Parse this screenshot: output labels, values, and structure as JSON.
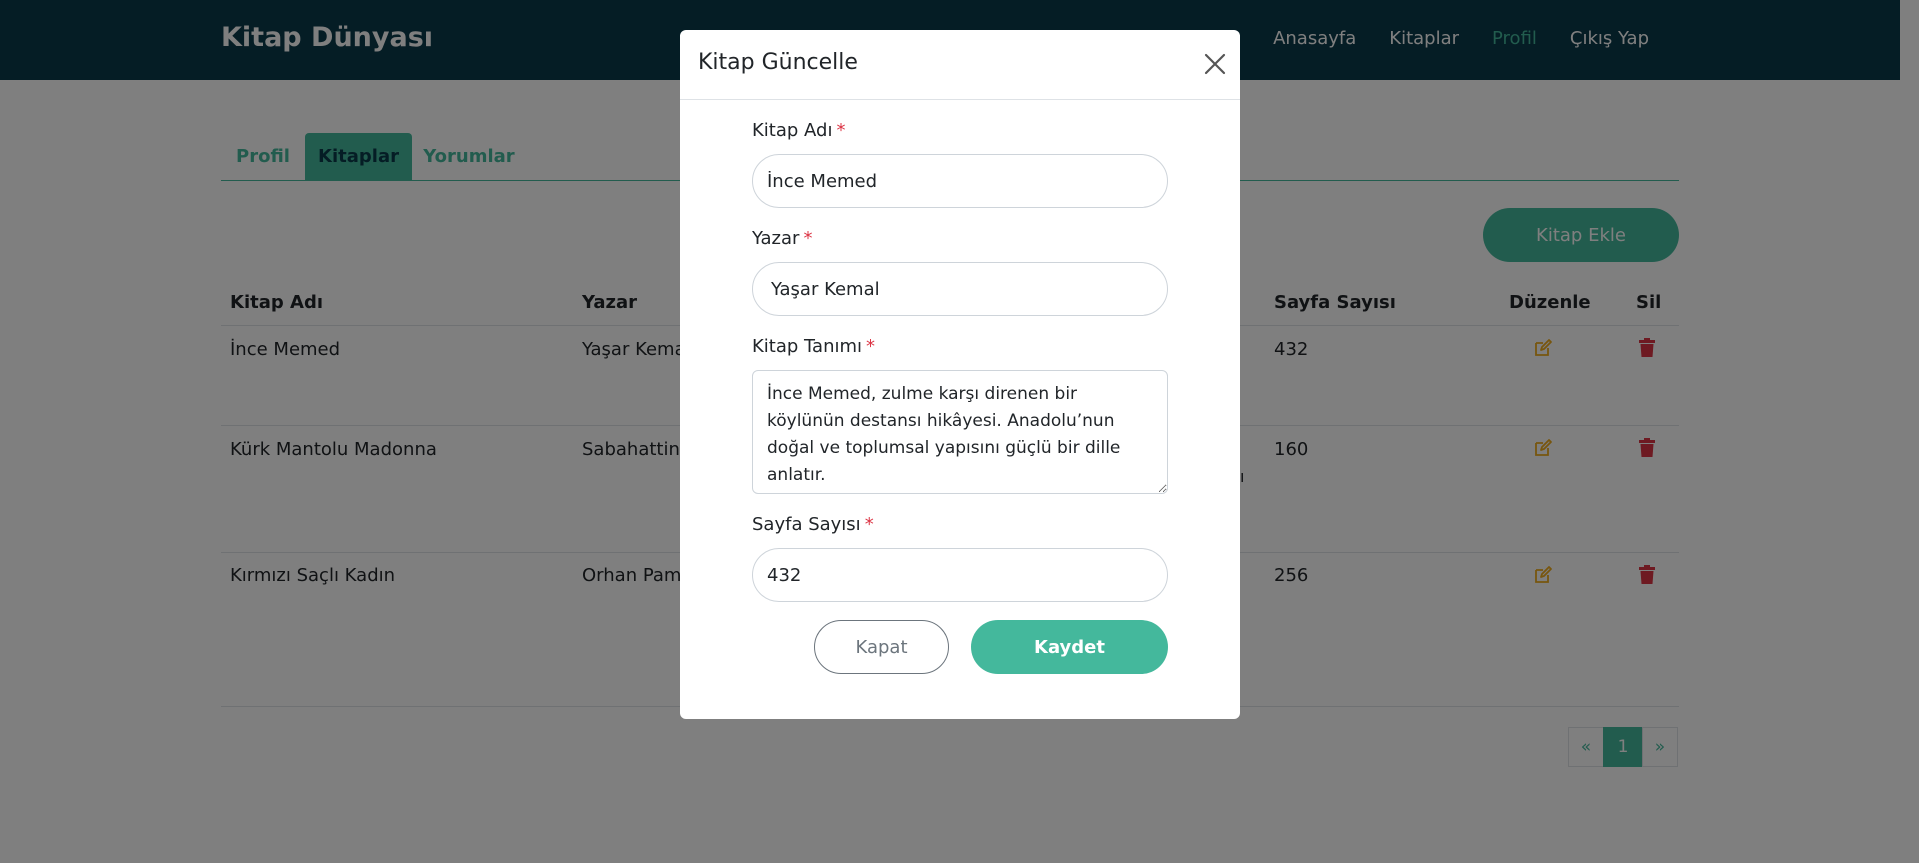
{
  "navbar": {
    "brand": "Kitap Dünyası",
    "links": [
      "Anasayfa",
      "Kitaplar",
      "Profil",
      "Çıkış Yap"
    ],
    "active_link": "Profil"
  },
  "tabs": [
    "Profil",
    "Kitaplar",
    "Yorumlar"
  ],
  "active_tab": "Kitaplar",
  "add_button": "Kitap Ekle",
  "table": {
    "headers": {
      "title": "Kitap Adı",
      "author": "Yazar",
      "pages": "Sayfa Sayısı",
      "edit": "Düzenle",
      "delete": "Sil"
    },
    "rows": [
      {
        "title": "İnce Memed",
        "author": "Yaşar Kema",
        "pages": "432"
      },
      {
        "title": "Kürk Mantolu Madonna",
        "author": "Sabahattin",
        "pages": "160",
        "desc_fragment": "ı"
      },
      {
        "title": "Kırmızı Saçlı Kadın",
        "author": "Orhan Pam",
        "pages": "256"
      }
    ]
  },
  "pagination": {
    "prev": "«",
    "current": "1",
    "next": "»"
  },
  "modal": {
    "title": "Kitap Güncelle",
    "required_mark": "*",
    "fields": {
      "title_label": "Kitap Adı",
      "title_value": "İnce Memed",
      "author_label": "Yazar",
      "author_value": "Yaşar Kemal",
      "desc_label": "Kitap Tanımı",
      "desc_value": "İnce Memed, zulme karşı direnen bir köylünün destansı hikâyesi. Anadolu’nun doğal ve toplumsal yapısını güçlü bir dille anlatır.",
      "pages_label": "Sayfa Sayısı",
      "pages_value": "432"
    },
    "close_button": "Kapat",
    "save_button": "Kaydet"
  },
  "colors": {
    "navbar": "#0b3a4a",
    "accent": "#44b89c",
    "edit_icon": "#f0ad1c",
    "delete_icon": "#dc3545",
    "required": "#dc3545"
  },
  "icons": {
    "edit": "edit-icon",
    "delete": "trash-icon",
    "close": "close-icon"
  }
}
